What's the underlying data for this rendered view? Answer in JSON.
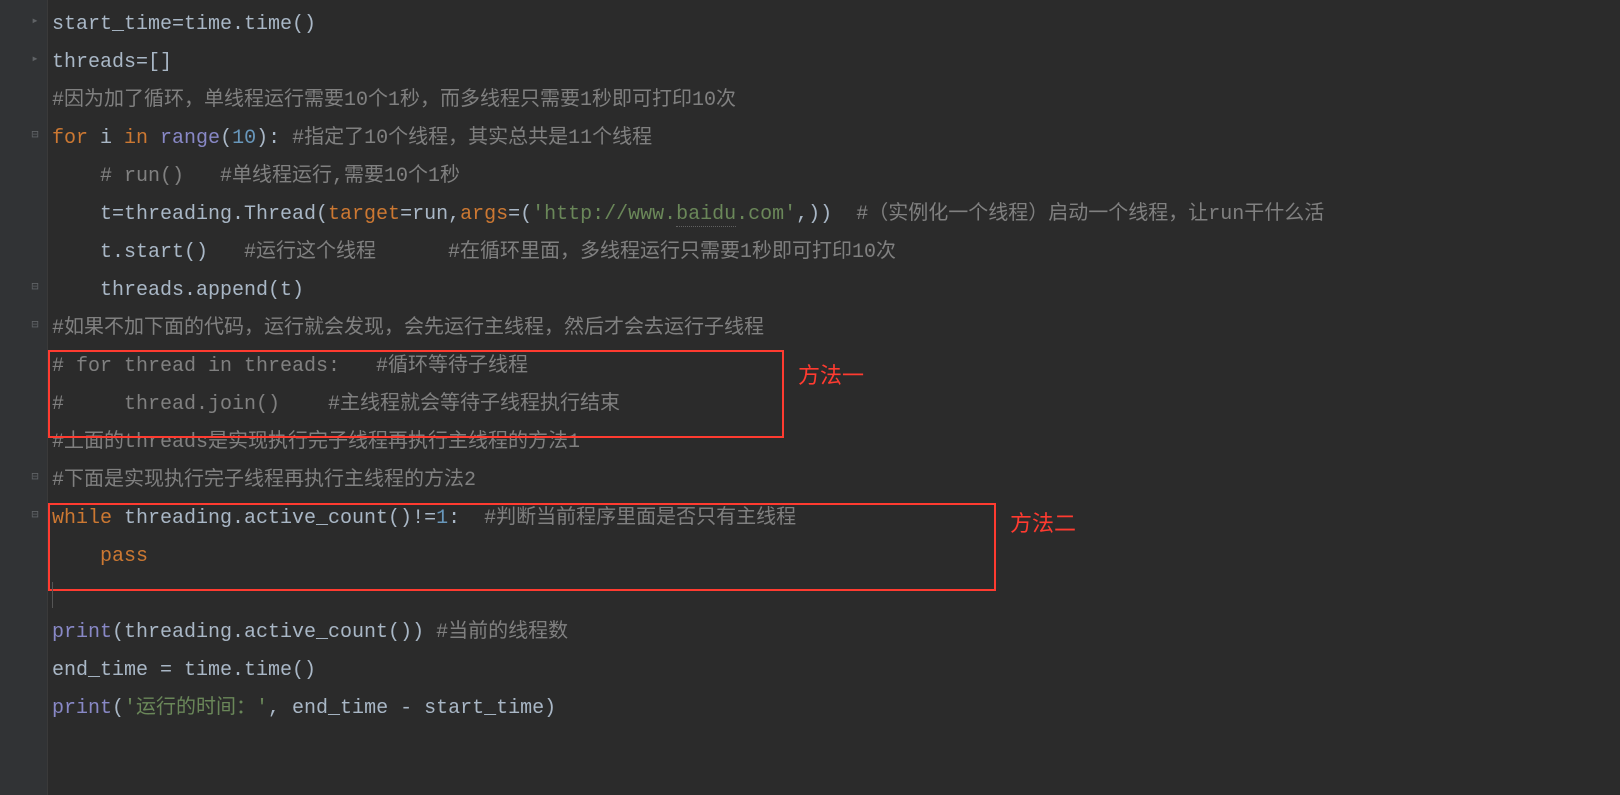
{
  "lines": {
    "l1": {
      "p1": "start_time=time.time()"
    },
    "l2": {
      "p1": "threads=[]"
    },
    "l3": {
      "p1": "#因为加了循环，单线程运行需要10个1秒，而多线程只需要1秒即可打印10次"
    },
    "l4": {
      "kw1": "for ",
      "id1": "i ",
      "kw2": "in ",
      "fn1": "range",
      "p1": "(",
      "n1": "10",
      "p2": "): ",
      "c1": "#指定了10个线程，其实总共是11个线程"
    },
    "l5": {
      "c1": "    # run()   #单线程运行,需要10个1秒"
    },
    "l6": {
      "p1": "    t=threading.Thread(",
      "pa1": "target",
      "p2": "=run,",
      "pa2": "args",
      "p3": "=(",
      "s1": "'http://www.",
      "s2": "baidu",
      "s3": ".com'",
      "p4": ",))  ",
      "c1": "#（实例化一个线程）启动一个线程，让run干什么活"
    },
    "l7": {
      "p1": "    t.start()   ",
      "c1": "#运行这个线程      #在循环里面，多线程运行只需要1秒即可打印10次"
    },
    "l8": {
      "p1": "    threads.append(t)"
    },
    "l9": {
      "c1": "#如果不加下面的代码，运行就会发现，会先运行主线程，然后才会去运行子线程"
    },
    "l10": {
      "c1": "# for thread in threads:   #循环等待子线程"
    },
    "l11": {
      "c1": "#     thread.join()    #主线程就会等待子线程执行结束"
    },
    "l12": {
      "c1": "#上面的threads是实现执行完子线程再执行主线程的方法1"
    },
    "l13": {
      "c1": "#下面是实现执行完子线程再执行主线程的方法2"
    },
    "l14": {
      "kw1": "while ",
      "p1": "threading.active_count()!=",
      "n1": "1",
      "p2": ":  ",
      "c1": "#判断当前程序里面是否只有主线程"
    },
    "l15": {
      "sp": "    ",
      "kw1": "pass"
    },
    "l16": {
      "blank": " "
    },
    "l17": {
      "fn1": "print",
      "p1": "(threading.active_count()) ",
      "c1": "#当前的线程数"
    },
    "l18": {
      "p1": "end_time = time.time()"
    },
    "l19": {
      "fn1": "print",
      "p1": "(",
      "s1": "'运行的时间：'",
      "p2": ", end_time - start_time)"
    }
  },
  "annotations": {
    "label1": "方法一",
    "label2": "方法二"
  }
}
